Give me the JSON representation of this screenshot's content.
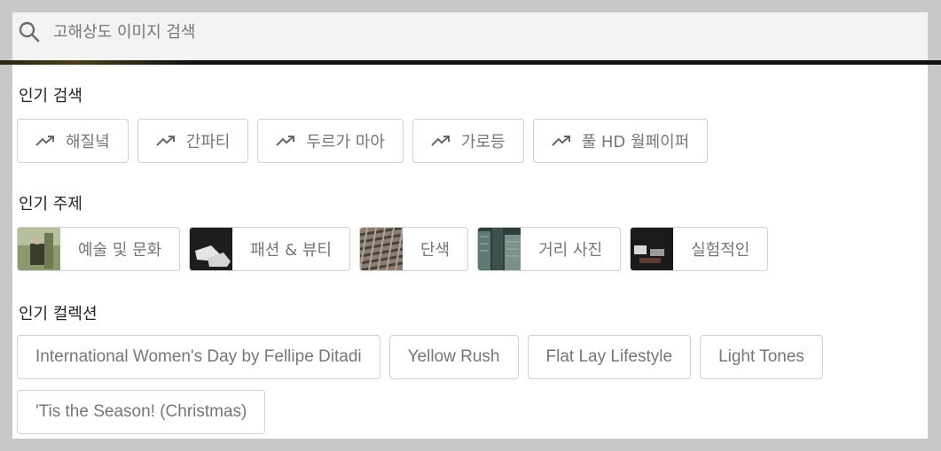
{
  "search": {
    "placeholder": "고해상도 이미지 검색"
  },
  "popular_searches": {
    "title": "인기 검색",
    "items": [
      "해질녘",
      "간파티",
      "두르가 마아",
      "가로등",
      "풀 HD 월페이퍼"
    ]
  },
  "popular_topics": {
    "title": "인기 주제",
    "items": [
      {
        "label": "예술 및 문화",
        "thumb": "art-culture-thumbnail"
      },
      {
        "label": "패션 & 뷰티",
        "thumb": "fashion-sneakers-thumbnail"
      },
      {
        "label": "단색",
        "thumb": "monochrome-texture-thumbnail"
      },
      {
        "label": "거리 사진",
        "thumb": "street-buildings-thumbnail"
      },
      {
        "label": "실험적인",
        "thumb": "experimental-thumbnail"
      }
    ]
  },
  "popular_collections": {
    "title": "인기 컬렉션",
    "items": [
      "International Women's Day by Fellipe Ditadi",
      "Yellow Rush",
      "Flat Lay Lifestyle",
      "Light Tones",
      "'Tis the Season! (Christmas)"
    ]
  },
  "colors": {
    "panel": "#ffffff",
    "chip_border": "#d1d1d1",
    "chip_text": "#767676",
    "search_bg": "#f3f3f3"
  }
}
